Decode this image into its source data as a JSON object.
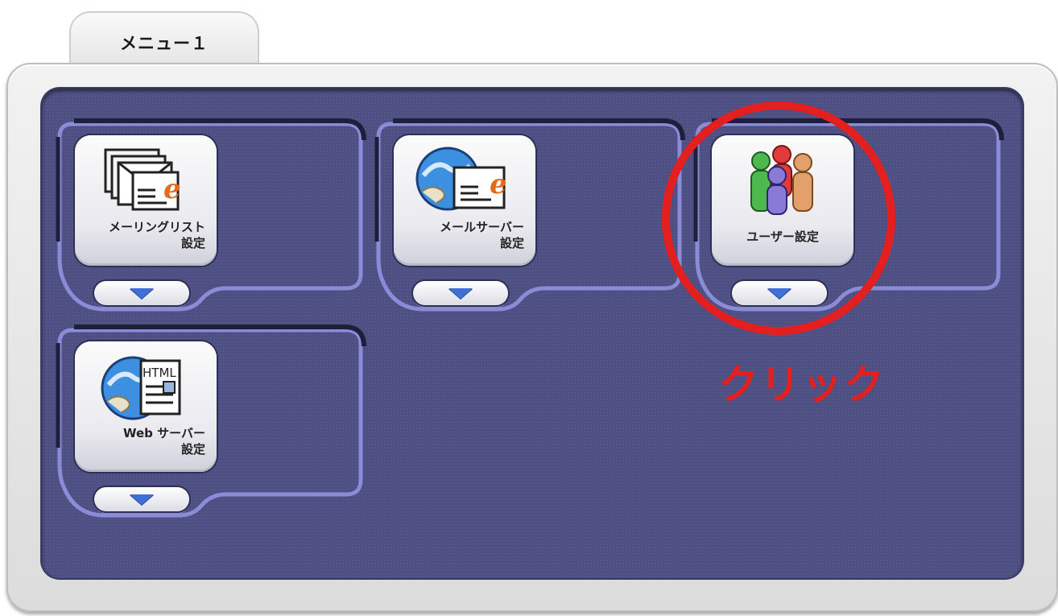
{
  "tab": {
    "label": "メニュー１"
  },
  "menu_items": [
    {
      "label": "メーリングリスト\n設定",
      "icon": "mailing-list-icon",
      "arrow": "expand-arrow"
    },
    {
      "label": "メールサーバー\n設定",
      "icon": "mail-server-icon",
      "arrow": "expand-arrow"
    },
    {
      "label": "ユーザー設定",
      "icon": "users-icon",
      "arrow": "expand-arrow"
    },
    {
      "label": "Web サーバー\n設定",
      "icon": "web-server-icon",
      "arrow": "expand-arrow"
    }
  ],
  "annotation": {
    "text": "クリック"
  },
  "colors": {
    "panel": "#4d4e81",
    "frame": "#e6e6e6",
    "accent_outline": "#8a8cd8",
    "highlight": "#e31f1f",
    "arrow": "#3f6fd8"
  }
}
